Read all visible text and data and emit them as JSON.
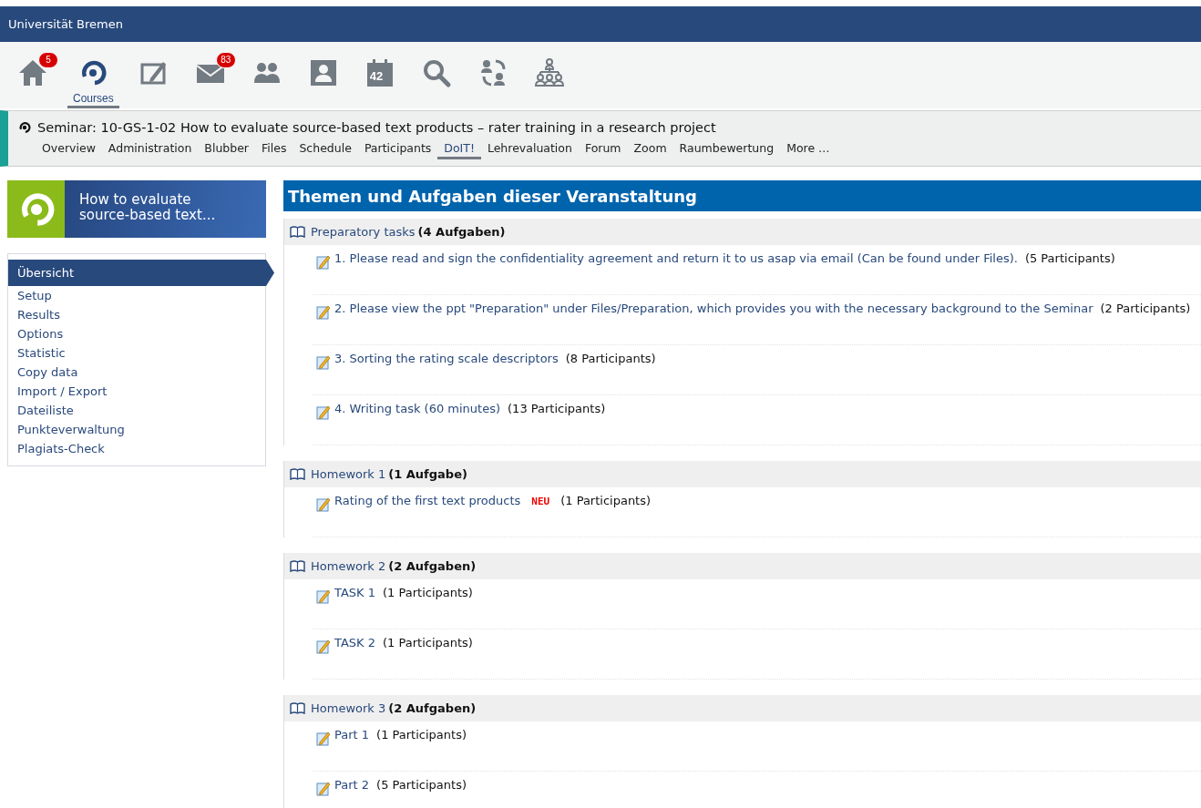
{
  "header": {
    "title": "Universität Bremen"
  },
  "nav_icons": [
    {
      "kind": "home",
      "badge": "5",
      "selected": false
    },
    {
      "kind": "courses",
      "label": "Courses",
      "selected": true
    },
    {
      "kind": "notepad",
      "selected": false
    },
    {
      "kind": "mail",
      "badge": "83",
      "selected": false
    },
    {
      "kind": "people",
      "selected": false
    },
    {
      "kind": "profile",
      "selected": false
    },
    {
      "kind": "calendar",
      "text": "42",
      "selected": false
    },
    {
      "kind": "search",
      "selected": false
    },
    {
      "kind": "exchange",
      "selected": false
    },
    {
      "kind": "hierarchy",
      "selected": false
    }
  ],
  "course": {
    "title": "Seminar: 10-GS-1-02 How to evaluate source-based text products – rater training in a research project",
    "tabs": [
      {
        "label": "Overview",
        "selected": false
      },
      {
        "label": "Administration",
        "selected": false
      },
      {
        "label": "Blubber",
        "selected": false
      },
      {
        "label": "Files",
        "selected": false
      },
      {
        "label": "Schedule",
        "selected": false
      },
      {
        "label": "Participants",
        "selected": false
      },
      {
        "label": "DoIT!",
        "selected": true
      },
      {
        "label": "Lehrevaluation",
        "selected": false
      },
      {
        "label": "Forum",
        "selected": false
      },
      {
        "label": "Zoom",
        "selected": false
      },
      {
        "label": "Raumbewertung",
        "selected": false
      },
      {
        "label": "More …",
        "selected": false
      }
    ]
  },
  "sidebar": {
    "banner": "How to evaluate source-based text...",
    "items": [
      {
        "label": "Übersicht",
        "selected": true
      },
      {
        "label": "Setup",
        "selected": false
      },
      {
        "label": "Results",
        "selected": false
      },
      {
        "label": "Options",
        "selected": false
      },
      {
        "label": "Statistic",
        "selected": false
      },
      {
        "label": "Copy data",
        "selected": false
      },
      {
        "label": "Import / Export",
        "selected": false
      },
      {
        "label": "Dateiliste",
        "selected": false
      },
      {
        "label": "Punkteverwaltung",
        "selected": false
      },
      {
        "label": "Plagiats-Check",
        "selected": false
      }
    ]
  },
  "content": {
    "title": "Themen und Aufgaben dieser Veranstaltung",
    "sections": [
      {
        "title": "Preparatory tasks",
        "count": "(4 Aufgaben)",
        "tasks": [
          {
            "title": "1. Please read and sign the confidentiality agreement and return it to us asap via email (Can be found under Files).",
            "participants": "(5 Participants)"
          },
          {
            "title": "2. Please view the ppt \"Preparation\" under Files/Preparation, which provides you with the necessary background to the Seminar",
            "participants": "(2 Participants)"
          },
          {
            "title": "3. Sorting the rating scale descriptors",
            "participants": "(8 Participants)"
          },
          {
            "title": "4. Writing task (60 minutes)",
            "participants": "(13 Participants)"
          }
        ]
      },
      {
        "title": "Homework 1",
        "count": "(1 Aufgabe)",
        "tasks": [
          {
            "title": "Rating of the first text products",
            "new_badge": "NEU",
            "participants": "(1 Participants)"
          }
        ]
      },
      {
        "title": "Homework 2",
        "count": "(2 Aufgaben)",
        "tasks": [
          {
            "title": "TASK 1",
            "participants": "(1 Participants)"
          },
          {
            "title": "TASK 2",
            "participants": "(1 Participants)"
          }
        ]
      },
      {
        "title": "Homework 3",
        "count": "(2 Aufgaben)",
        "tasks": [
          {
            "title": "Part 1",
            "participants": "(1 Participants)"
          },
          {
            "title": "Part 2",
            "participants": "(5 Participants)"
          }
        ]
      }
    ]
  }
}
